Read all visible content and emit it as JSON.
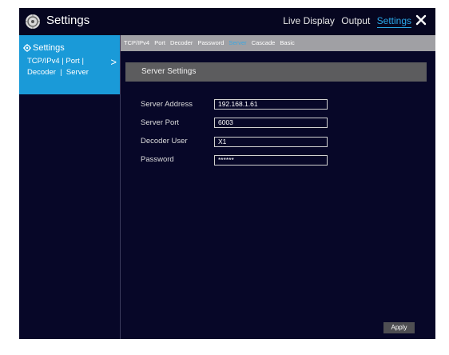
{
  "app": {
    "title": "Settings"
  },
  "topnav": {
    "items": [
      "Live Display",
      "Output",
      "Settings"
    ],
    "active": "Settings"
  },
  "sidebar": {
    "title": "Settings",
    "subtitle_line1": "TCP/IPv4 | Port |",
    "subtitle_line2": "Decoder  |  Server",
    "chevron": ">"
  },
  "tabs": {
    "items": [
      "TCP/IPv4",
      "Port",
      "Decoder",
      "Password",
      "Server",
      "Cascade",
      "Basic"
    ],
    "active": "Server"
  },
  "section": {
    "title": "Server Settings"
  },
  "form": {
    "server_address": {
      "label": "Server Address",
      "value": "192.168.1.61"
    },
    "server_port": {
      "label": "Server Port",
      "value": "6003"
    },
    "decoder_user": {
      "label": "Decoder User",
      "value": "X1"
    },
    "password": {
      "label": "Password",
      "value": "******"
    }
  },
  "buttons": {
    "apply": "Apply"
  },
  "colors": {
    "background": "#070728",
    "accent": "#1a9ad8",
    "tabbar": "#a0a0a4",
    "section_header": "#5c5c5e"
  },
  "icons": {
    "logo": "app-logo-icon",
    "close": "close-icon",
    "settings": "gear-icon"
  }
}
